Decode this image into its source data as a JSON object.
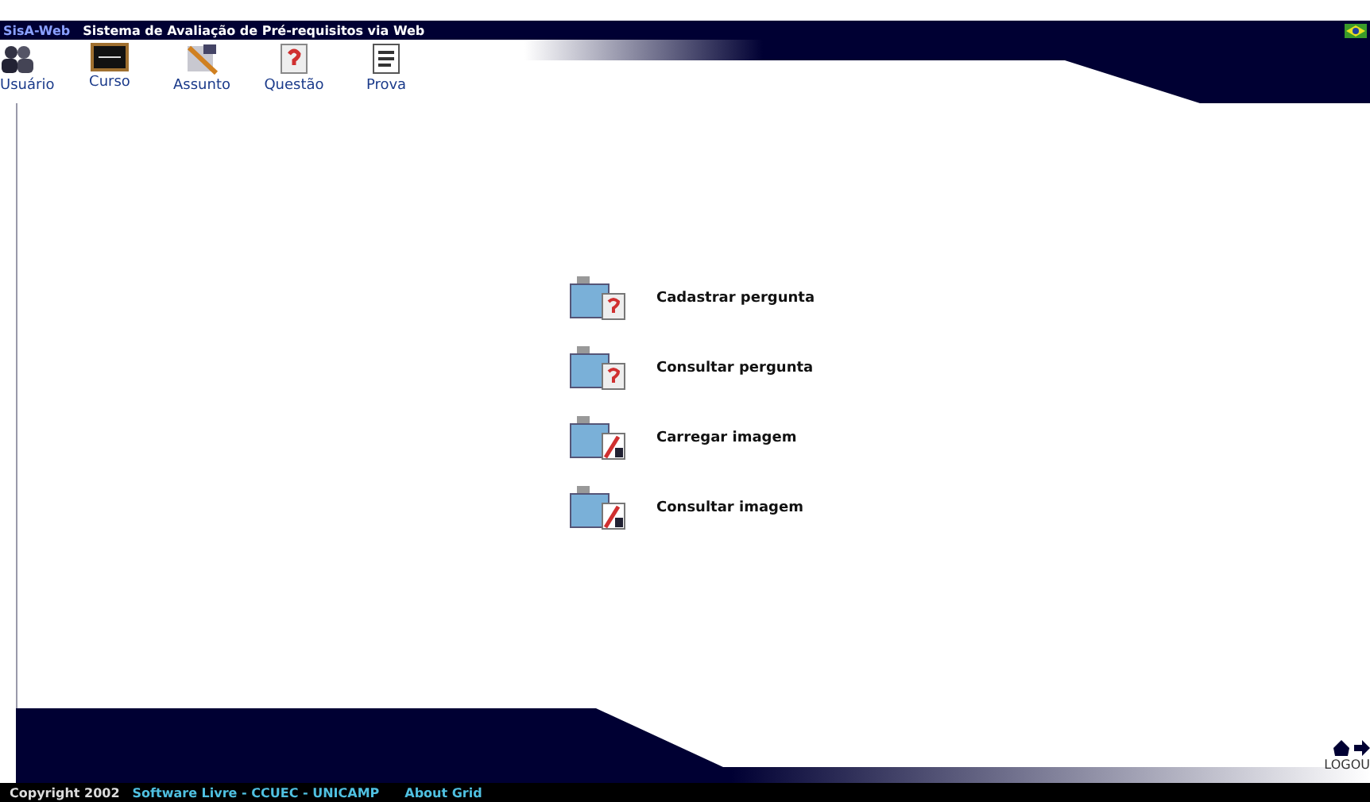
{
  "header": {
    "app_name": "SisA-Web",
    "title": "Sistema de Avaliação de Pré-requisitos via Web"
  },
  "toolbar": [
    {
      "label": "Usuário",
      "kind": "users"
    },
    {
      "label": "Curso",
      "kind": "course"
    },
    {
      "label": "Assunto",
      "kind": "subject"
    },
    {
      "label": "Questão",
      "kind": "question"
    },
    {
      "label": "Prova",
      "kind": "exam"
    }
  ],
  "menu": [
    {
      "label": "Cadastrar pergunta",
      "kind": "question"
    },
    {
      "label": "Consultar pergunta",
      "kind": "question"
    },
    {
      "label": "Carregar imagem",
      "kind": "image"
    },
    {
      "label": "Consultar imagem",
      "kind": "image"
    }
  ],
  "footer": {
    "copyright": "Copyright 2002",
    "credits": "Software Livre - CCUEC - UNICAMP",
    "link": "About Grid",
    "logout": "LOGOU"
  }
}
